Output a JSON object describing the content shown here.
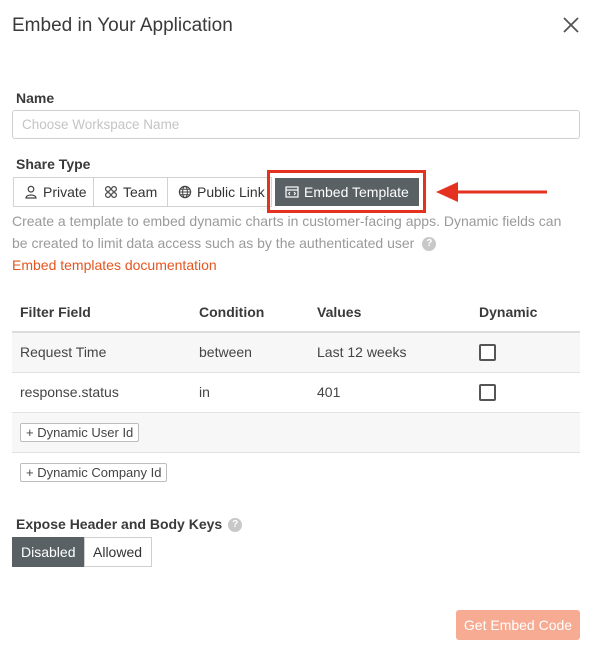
{
  "dialog": {
    "title": "Embed in Your Application"
  },
  "name": {
    "label": "Name",
    "placeholder": "Choose Workspace Name",
    "value": ""
  },
  "share_type": {
    "label": "Share Type",
    "options": [
      {
        "label": "Private",
        "icon": "person-icon",
        "selected": false
      },
      {
        "label": "Team",
        "icon": "team-icon",
        "selected": false
      },
      {
        "label": "Public Link",
        "icon": "globe-icon",
        "selected": false
      },
      {
        "label": "Embed Template",
        "icon": "embed-template-icon",
        "selected": true
      }
    ],
    "description_line1": "Create a template to embed dynamic charts in customer-facing apps. Dynamic fields can",
    "description_line2": "be created to limit data access such as by the authenticated user",
    "help_glyph": "?",
    "doc_link": "Embed templates documentation"
  },
  "filters": {
    "headers": [
      "Filter Field",
      "Condition",
      "Values",
      "Dynamic"
    ],
    "rows": [
      {
        "field": "Request Time",
        "condition": "between",
        "value": "Last 12 weeks",
        "dynamic": false
      },
      {
        "field": "response.status",
        "condition": "in",
        "value": "401",
        "dynamic": false
      }
    ],
    "add_user_id": "+ Dynamic User Id",
    "add_company_id": "+ Dynamic Company Id"
  },
  "expose": {
    "label": "Expose Header and Body Keys",
    "help_glyph": "?",
    "options": [
      {
        "label": "Disabled",
        "selected": true
      },
      {
        "label": "Allowed",
        "selected": false
      }
    ]
  },
  "footer": {
    "primary_label": "Get Embed Code"
  },
  "colors": {
    "accent": "#e4551f",
    "highlight": "#e5311f",
    "active": "#596165",
    "primary_disabled": "#f6ab92"
  }
}
